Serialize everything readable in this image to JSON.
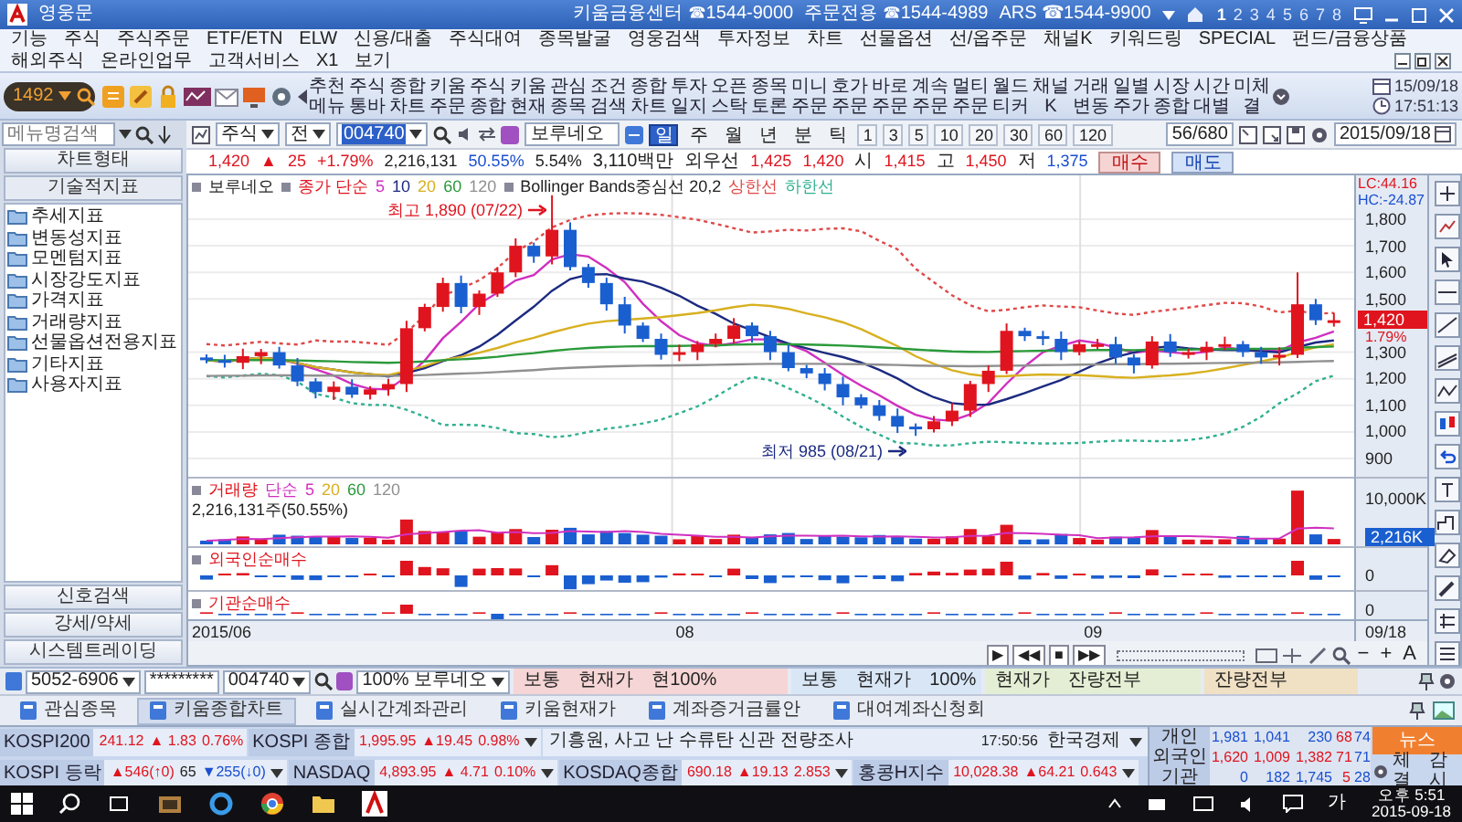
{
  "window": {
    "title": "영웅문",
    "contacts": [
      "키움금융센터 ☎1544-9000",
      "주문전용 ☎1544-4989",
      "ARS ☎1544-9900"
    ],
    "screens": [
      {
        "label": "1",
        "selected": true
      },
      {
        "label": "2",
        "selected": false
      },
      {
        "label": "3",
        "selected": false
      },
      {
        "label": "4",
        "selected": false
      },
      {
        "label": "5",
        "selected": false
      },
      {
        "label": "6",
        "selected": false
      },
      {
        "label": "7",
        "selected": false
      },
      {
        "label": "8",
        "selected": false
      }
    ]
  },
  "menu": [
    "기능",
    "주식",
    "주식주문",
    "ETF/ETN",
    "ELW",
    "신용/대출",
    "주식대여",
    "종목발굴",
    "영웅검색",
    "투자정보",
    "차트",
    "선물옵션",
    "선/옵주문",
    "채널K",
    "키워드링",
    "SPECIAL",
    "펀드/금융상품",
    "해외주식",
    "온라인업무",
    "고객서비스",
    "X1",
    "보기"
  ],
  "toolbar": {
    "stock_code": "1492",
    "buttons": [
      "추천메뉴",
      "주식통바",
      "종합차트",
      "키움주문",
      "주식종합",
      "키움현재",
      "관심종목",
      "조건검색",
      "종합차트",
      "투자일지",
      "오픈스탁",
      "종목토론",
      "미니주문",
      "호가주문",
      "바로주문",
      "계속주문",
      "멀티주문",
      "월드티커",
      "채널K",
      "거래변동",
      "일별주가",
      "시장종합",
      "시간대별",
      "미체결"
    ],
    "date": "15/09/18",
    "time": "17:51:13"
  },
  "menu_search": {
    "placeholder": "메뉴명검색"
  },
  "sidebar": {
    "chart_type_button": "차트형태",
    "header": "기술적지표",
    "items": [
      "추세지표",
      "변동성지표",
      "모멘텀지표",
      "시장강도지표",
      "가격지표",
      "거래량지표",
      "선물옵션전용지표",
      "기타지표",
      "사용자지표"
    ],
    "bottom_buttons": [
      "신호검색",
      "강세/약세",
      "시스템트레이딩"
    ]
  },
  "chart_toolbar": {
    "market": "주식",
    "scope": "전",
    "code": "004740",
    "name": "보루네오",
    "periods": [
      {
        "label": "일",
        "selected": true
      },
      {
        "label": "주",
        "selected": false
      },
      {
        "label": "월",
        "selected": false
      },
      {
        "label": "년",
        "selected": false
      },
      {
        "label": "분",
        "selected": false
      },
      {
        "label": "틱",
        "selected": false
      }
    ],
    "intervals": [
      "1",
      "3",
      "5",
      "10",
      "20",
      "30",
      "60",
      "120"
    ],
    "count": "56/680",
    "date": "2015/09/18"
  },
  "quote": {
    "items": [
      {
        "text": "1,420",
        "color": "#e0141e"
      },
      {
        "text": "▲",
        "color": "#e0141e"
      },
      {
        "text": "25",
        "color": "#e0141e"
      },
      {
        "text": "+1.79%",
        "color": "#e0141e"
      },
      {
        "text": "2,216,131",
        "color": "#222222"
      },
      {
        "text": "50.55%",
        "color": "#1a4fd0"
      },
      {
        "text": "5.54%",
        "color": "#222222"
      },
      {
        "text": "3,110백만",
        "color": "#222222"
      },
      {
        "text": "외우선",
        "color": "#222222"
      },
      {
        "text": "1,425",
        "color": "#e0141e"
      },
      {
        "text": "1,420",
        "color": "#e0141e"
      },
      {
        "text": "시",
        "color": "#222222"
      },
      {
        "text": "1,415",
        "color": "#e0141e"
      },
      {
        "text": "고",
        "color": "#222222"
      },
      {
        "text": "1,450",
        "color": "#e0141e"
      },
      {
        "text": "저",
        "color": "#222222"
      },
      {
        "text": "1,375",
        "color": "#1a4fd0"
      }
    ],
    "buy_button": "매수",
    "sell_button": "매도"
  },
  "chart": {
    "legend": {
      "stock": "보루네오",
      "ma_label": "종가 단순",
      "ma": [
        {
          "label": "5",
          "color": "#d030c0"
        },
        {
          "label": "10",
          "color": "#1c2a80"
        },
        {
          "label": "20",
          "color": "#d8b020"
        },
        {
          "label": "60",
          "color": "#2a9a3a"
        },
        {
          "label": "120",
          "color": "#909090"
        }
      ],
      "bb_label": "Bollinger Bands중심선 20,2",
      "bands": [
        {
          "label": "상한선",
          "color": "#e04848"
        },
        {
          "label": "하한선",
          "color": "#30b090"
        }
      ]
    },
    "high_note": "최고 1,890 (07/22)",
    "low_note": "최저 985 (08/21)",
    "lc": "LC:44.16",
    "hc": "HC:-24.87",
    "y_ticks": [
      "1,800",
      "1,700",
      "1,600",
      "1,500",
      "1,300",
      "1,200",
      "1,100",
      "1,000",
      "900"
    ],
    "price_tag": "1,420",
    "price_change": "1.79%",
    "volume": {
      "title": "거래량",
      "ma_label": "단순",
      "ma": [
        {
          "label": "5",
          "color": "#d030c0"
        },
        {
          "label": "20",
          "color": "#d8b020"
        },
        {
          "label": "60",
          "color": "#2a9a3a"
        },
        {
          "label": "120",
          "color": "#909090"
        }
      ],
      "summary": "2,216,131주(50.55%)",
      "tick": "10,000K",
      "tag": "2,216K"
    },
    "foreign": {
      "title": "외국인순매수",
      "tick": "0"
    },
    "institution": {
      "title": "기관순매수",
      "tick": "0"
    },
    "x_axis": {
      "labels": [
        "2015/06",
        "08",
        "09"
      ],
      "end": "09/18"
    },
    "playback": [
      "▶",
      "◀◀",
      "■",
      "▶▶"
    ],
    "zoom_controls": [
      "−",
      "+",
      "A"
    ]
  },
  "order_bar": {
    "account": "5052-6906",
    "password": "*********",
    "code": "004740",
    "ratio": "100%",
    "name": "보루네오",
    "segments": [
      {
        "texts": [
          "보통",
          "현재가",
          "현100%"
        ],
        "color": "#f5d5d5"
      },
      {
        "texts": [
          "보통",
          "현재가",
          "100%"
        ],
        "color": "#d8e6f6"
      },
      {
        "texts": [
          "현재가",
          "잔량전부"
        ],
        "color": "#e4eed4"
      },
      {
        "texts": [
          "잔량전부"
        ],
        "color": "#f0e0c4"
      }
    ]
  },
  "tabs": [
    {
      "label": "관심종목",
      "selected": false
    },
    {
      "label": "키움종합차트",
      "selected": true
    },
    {
      "label": "실시간계좌관리",
      "selected": false
    },
    {
      "label": "키움현재가",
      "selected": false
    },
    {
      "label": "계좌증거금률안",
      "selected": false
    },
    {
      "label": "대여계좌신청회",
      "selected": false
    }
  ],
  "tickers": {
    "rows": [
      [
        {
          "name": "KOSPI200",
          "parts": [
            {
              "text": "241.12",
              "color": "#e0141e"
            },
            {
              "text": "▲ 1.83",
              "color": "#e0141e"
            },
            {
              "text": "0.76%",
              "color": "#e0141e"
            }
          ],
          "dropdown": false
        },
        {
          "name": "KOSPI 종합",
          "parts": [
            {
              "text": "1,995.95",
              "color": "#e0141e"
            },
            {
              "text": "▲19.45",
              "color": "#e0141e"
            },
            {
              "text": "0.98%",
              "color": "#e0141e"
            }
          ],
          "dropdown": true
        }
      ],
      [
        {
          "name": "KOSPI 등락",
          "parts": [
            {
              "text": "▲546(↑0)",
              "color": "#e0141e"
            },
            {
              "text": "65",
              "color": "#222222"
            },
            {
              "text": "▼255(↓0)",
              "color": "#1a4fd0"
            }
          ],
          "dropdown": true
        },
        {
          "name": "NASDAQ",
          "parts": [
            {
              "text": "4,893.95",
              "color": "#e0141e"
            },
            {
              "text": "▲ 4.71",
              "color": "#e0141e"
            },
            {
              "text": "0.10%",
              "color": "#e0141e"
            }
          ],
          "dropdown": true
        },
        {
          "name": "KOSDAQ종합",
          "parts": [
            {
              "text": "690.18",
              "color": "#e0141e"
            },
            {
              "text": "▲19.13",
              "color": "#e0141e"
            },
            {
              "text": "2.853",
              "color": "#e0141e"
            }
          ],
          "dropdown": true
        },
        {
          "name": "홍콩H지수",
          "parts": [
            {
              "text": "10,028.38",
              "color": "#e0141e"
            },
            {
              "text": "▲64.21",
              "color": "#e0141e"
            },
            {
              "text": "0.643",
              "color": "#e0141e"
            }
          ],
          "dropdown": true
        }
      ]
    ]
  },
  "news": {
    "headline": "기흥원, 사고 난 수류탄 신관 전량조사",
    "time": "17:50:56",
    "source": "한국경제"
  },
  "investors": {
    "rows": [
      {
        "label": "개인",
        "color": "#1a4fd0",
        "values": [
          "1,981",
          "1,041",
          "230"
        ],
        "extra": [
          "68",
          "74"
        ]
      },
      {
        "label": "외국인",
        "color": "#e0141e",
        "values": [
          "1,620",
          "1,009",
          "1,382"
        ],
        "extra": [
          "71",
          "71"
        ]
      },
      {
        "label": "기관",
        "color": "#1a4fd0",
        "values": [
          "0",
          "182",
          "1,745"
        ],
        "extra": [
          "5",
          "28"
        ]
      }
    ]
  },
  "news_button": "뉴스",
  "side_buttons": [
    "체결",
    "감시"
  ],
  "taskbar": {
    "ime": "가",
    "time": "오후 5:51",
    "date": "2015-09-18"
  }
}
